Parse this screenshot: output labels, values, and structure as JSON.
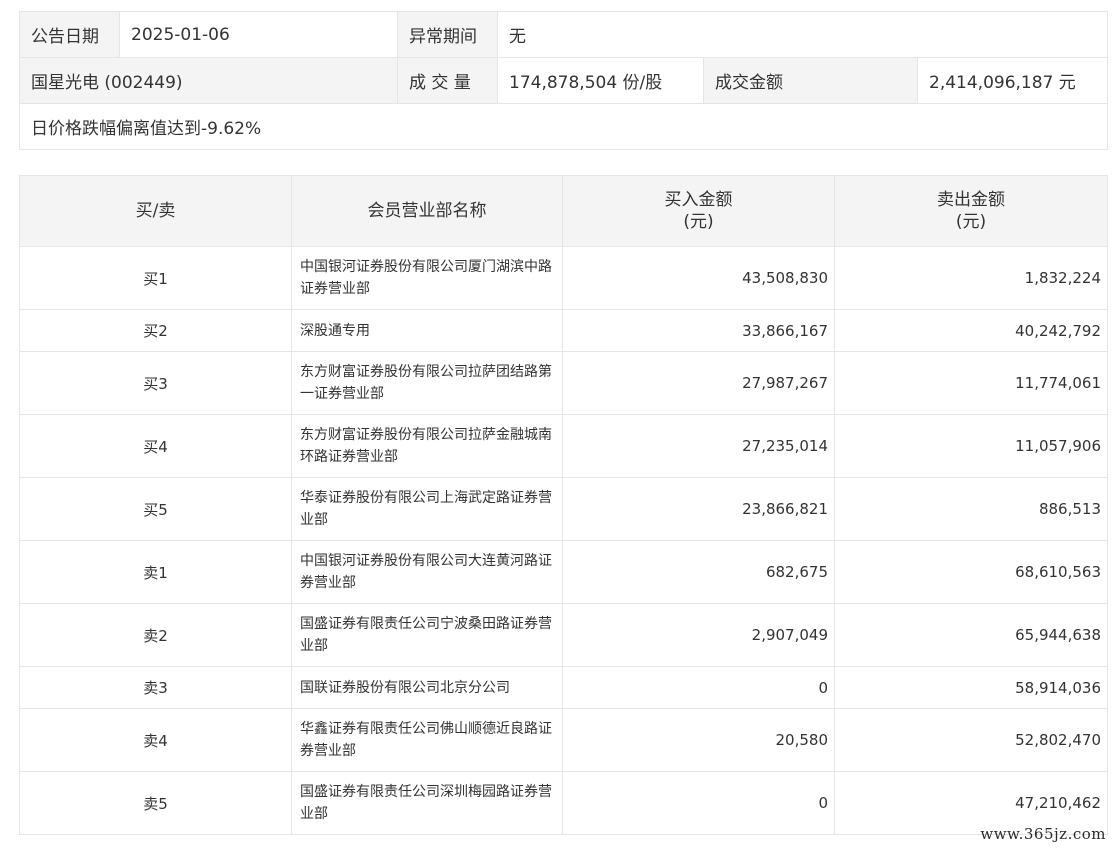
{
  "info": {
    "announce_date_label": "公告日期",
    "announce_date": "2025-01-06",
    "abnormal_period_label": "异常期间",
    "abnormal_period": "无",
    "stock": "国星光电 (002449)",
    "volume_label": "成 交 量",
    "volume": "174,878,504 份/股",
    "amount_label": "成交金额",
    "amount": "2,414,096,187 元",
    "reason": "日价格跌幅偏离值达到-9.62%"
  },
  "table": {
    "headers": {
      "side": "买/卖",
      "name": "会员营业部名称",
      "buy_line1": "买入金额",
      "buy_line2": "(元)",
      "sell_line1": "卖出金额",
      "sell_line2": "(元)"
    },
    "rows": [
      {
        "side": "买1",
        "name": "中国银河证券股份有限公司厦门湖滨中路证券营业部",
        "buy": "43,508,830",
        "sell": "1,832,224"
      },
      {
        "side": "买2",
        "name": "深股通专用",
        "buy": "33,866,167",
        "sell": "40,242,792"
      },
      {
        "side": "买3",
        "name": "东方财富证券股份有限公司拉萨团结路第一证券营业部",
        "buy": "27,987,267",
        "sell": "11,774,061"
      },
      {
        "side": "买4",
        "name": "东方财富证券股份有限公司拉萨金融城南环路证券营业部",
        "buy": "27,235,014",
        "sell": "11,057,906"
      },
      {
        "side": "买5",
        "name": "华泰证券股份有限公司上海武定路证券营业部",
        "buy": "23,866,821",
        "sell": "886,513"
      },
      {
        "side": "卖1",
        "name": "中国银河证券股份有限公司大连黄河路证券营业部",
        "buy": "682,675",
        "sell": "68,610,563"
      },
      {
        "side": "卖2",
        "name": "国盛证券有限责任公司宁波桑田路证券营业部",
        "buy": "2,907,049",
        "sell": "65,944,638"
      },
      {
        "side": "卖3",
        "name": "国联证券股份有限公司北京分公司",
        "buy": "0",
        "sell": "58,914,036"
      },
      {
        "side": "卖4",
        "name": "华鑫证券有限责任公司佛山顺德近良路证券营业部",
        "buy": "20,580",
        "sell": "52,802,470"
      },
      {
        "side": "卖5",
        "name": "国盛证券有限责任公司深圳梅园路证券营业部",
        "buy": "0",
        "sell": "47,210,462"
      }
    ]
  },
  "watermark": "www.365jz.com"
}
